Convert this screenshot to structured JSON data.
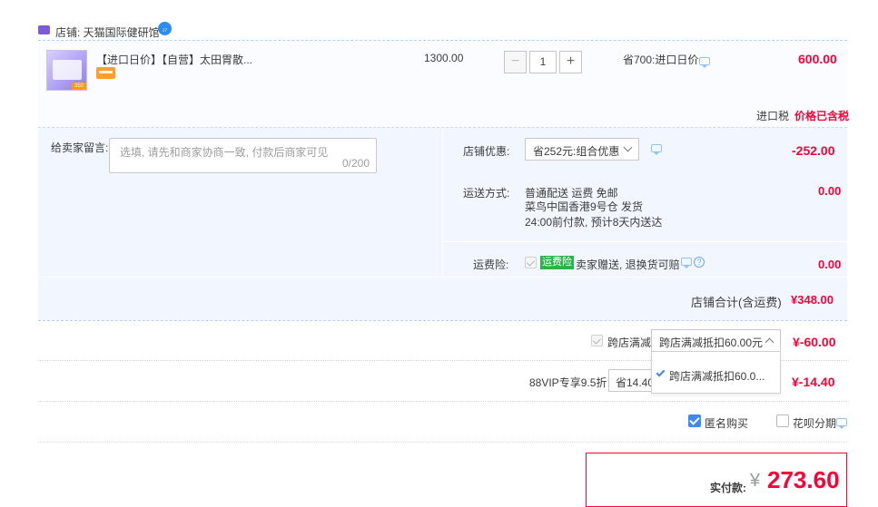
{
  "shop": {
    "label": "店铺: 天猫国际健研馆",
    "badge": "₁₇"
  },
  "product": {
    "title": "【进口日价】【自营】太田胃散...",
    "image_tag": "350",
    "unit_price": "1300.00",
    "quantity": "1",
    "minus": "−",
    "plus": "+",
    "saving": "省700:进口日价",
    "price": "600.00"
  },
  "tax": {
    "label": "进口税",
    "value": "价格已含税"
  },
  "message": {
    "label": "给卖家留言:",
    "placeholder": "选填, 请先和商家协商一致, 付款后商家可见",
    "count": "0/200"
  },
  "shop_discount": {
    "label": "店铺优惠:",
    "selected": "省252元:组合优惠",
    "value": "-252.00"
  },
  "shipping": {
    "label": "运送方式:",
    "line1": "普通配送 运费 免邮",
    "line2": "菜鸟中国香港9号仓   发货",
    "line3": "24:00前付款, 预计8天内送达",
    "value": "0.00"
  },
  "insurance": {
    "label": "运费险:",
    "badge": "运费险",
    "text": "卖家赠送, 退换货可赔",
    "help": "?",
    "value": "0.00"
  },
  "shop_total": {
    "label": "店铺合计(含运费)",
    "value": "¥348.00"
  },
  "cross_store": {
    "label": "跨店满减",
    "selected": "跨店满减抵扣60.00元",
    "value": "¥-60.00",
    "option": "跨店满减抵扣60.0..."
  },
  "vip": {
    "label": "88VIP专享9.5折",
    "selected": "省14.40",
    "value": "¥-14.40"
  },
  "options": {
    "anonymous": "匿名购买",
    "anonymous_checked": true,
    "huabei": "花呗分期",
    "huabei_checked": false
  },
  "total": {
    "label": "实付款:",
    "currency": "¥",
    "value": "273.60"
  },
  "colors": {
    "accent_red": "#ff0036",
    "accent_blue": "#3d8af7",
    "panel_bg": "#f2f7ff",
    "badge_green": "#2bb34a"
  }
}
